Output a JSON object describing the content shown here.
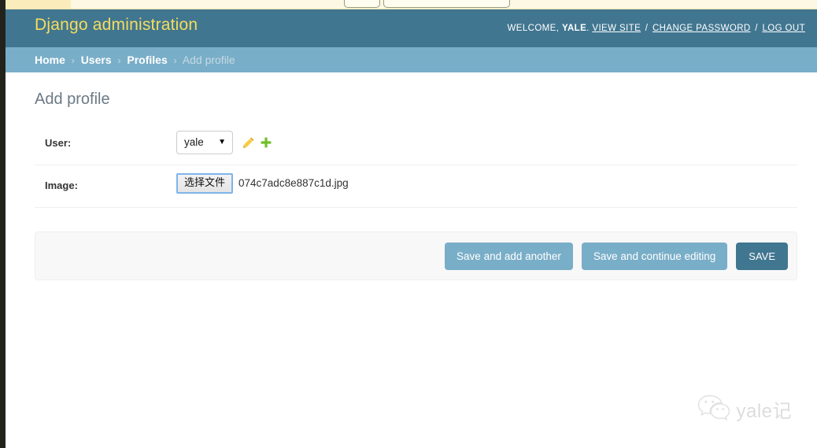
{
  "browser_strip": {
    "control_small": "",
    "control_wide": ""
  },
  "header": {
    "site_name": "Django administration",
    "welcome_prefix": "WELCOME,",
    "username": "YALE",
    "period": ".",
    "links": [
      {
        "label": "VIEW SITE",
        "name": "view-site-link"
      },
      {
        "label": "CHANGE PASSWORD",
        "name": "change-password-link"
      },
      {
        "label": "LOG OUT",
        "name": "log-out-link"
      }
    ],
    "separator": "/",
    "bg_color": "#417690",
    "title_color": "#f5dd5d"
  },
  "breadcrumbs": {
    "separator": "›",
    "items": [
      {
        "label": "Home",
        "current": false
      },
      {
        "label": "Users",
        "current": false
      },
      {
        "label": "Profiles",
        "current": false
      },
      {
        "label": "Add profile",
        "current": true
      }
    ],
    "bg_color": "#79aec8"
  },
  "main": {
    "page_title": "Add profile",
    "rows": [
      {
        "label": "User:",
        "widget": "select",
        "value": "yale",
        "arrow": "▼",
        "related_icons": [
          {
            "name": "edit-pencil-icon",
            "color": "#efb80b"
          },
          {
            "name": "add-plus-icon",
            "color": "#70bf2b"
          }
        ]
      },
      {
        "label": "Image:",
        "widget": "file",
        "button_label": "选择文件",
        "file_name": "074c7adc8e887c1d.jpg"
      }
    ]
  },
  "submit_row": {
    "buttons": [
      {
        "label": "Save and add another",
        "style": "secondary",
        "name": "save-and-add-another-button"
      },
      {
        "label": "Save and continue editing",
        "style": "secondary",
        "name": "save-and-continue-editing-button"
      },
      {
        "label": "SAVE",
        "style": "primary",
        "name": "save-button"
      }
    ],
    "bg_color": "#f8f8f8"
  },
  "watermark": {
    "text": "yale记",
    "icon": "wechat-icon"
  }
}
